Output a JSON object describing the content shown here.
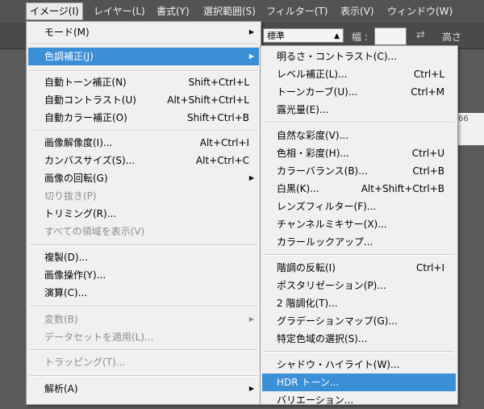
{
  "menubar": {
    "items": [
      {
        "label": "イメージ(I)"
      },
      {
        "label": "レイヤー(L)"
      },
      {
        "label": "書式(Y)"
      },
      {
        "label": "選択範囲(S)"
      },
      {
        "label": "フィルター(T)"
      },
      {
        "label": "表示(V)"
      },
      {
        "label": "ウィンドウ(W)"
      }
    ]
  },
  "optionsbar": {
    "style_value": "標準",
    "width_label": "幅 :",
    "height_label": "高さ"
  },
  "doc": {
    "fragment": "66"
  },
  "image_menu": {
    "items": [
      {
        "label": "モード(M)",
        "shortcut": "",
        "submenu": true
      },
      {
        "label": "色調補正(J)",
        "shortcut": "",
        "submenu": true
      },
      {
        "label": "自動トーン補正(N)",
        "shortcut": "Shift+Ctrl+L"
      },
      {
        "label": "自動コントラスト(U)",
        "shortcut": "Alt+Shift+Ctrl+L"
      },
      {
        "label": "自動カラー補正(O)",
        "shortcut": "Shift+Ctrl+B"
      },
      {
        "label": "画像解像度(I)...",
        "shortcut": "Alt+Ctrl+I"
      },
      {
        "label": "カンバスサイズ(S)...",
        "shortcut": "Alt+Ctrl+C"
      },
      {
        "label": "画像の回転(G)",
        "shortcut": "",
        "submenu": true
      },
      {
        "label": "切り抜き(P)",
        "shortcut": ""
      },
      {
        "label": "トリミング(R)...",
        "shortcut": ""
      },
      {
        "label": "すべての領域を表示(V)",
        "shortcut": ""
      },
      {
        "label": "複製(D)...",
        "shortcut": ""
      },
      {
        "label": "画像操作(Y)...",
        "shortcut": ""
      },
      {
        "label": "演算(C)...",
        "shortcut": ""
      },
      {
        "label": "変数(B)",
        "shortcut": "",
        "submenu": true
      },
      {
        "label": "データセットを適用(L)...",
        "shortcut": ""
      },
      {
        "label": "トラッピング(T)...",
        "shortcut": ""
      },
      {
        "label": "解析(A)",
        "shortcut": "",
        "submenu": true
      }
    ]
  },
  "adjust_menu": {
    "items": [
      {
        "label": "明るさ・コントラスト(C)...",
        "shortcut": ""
      },
      {
        "label": "レベル補正(L)...",
        "shortcut": "Ctrl+L"
      },
      {
        "label": "トーンカーブ(U)...",
        "shortcut": "Ctrl+M"
      },
      {
        "label": "露光量(E)...",
        "shortcut": ""
      },
      {
        "label": "自然な彩度(V)...",
        "shortcut": ""
      },
      {
        "label": "色相・彩度(H)...",
        "shortcut": "Ctrl+U"
      },
      {
        "label": "カラーバランス(B)...",
        "shortcut": "Ctrl+B"
      },
      {
        "label": "白黒(K)...",
        "shortcut": "Alt+Shift+Ctrl+B"
      },
      {
        "label": "レンズフィルター(F)...",
        "shortcut": ""
      },
      {
        "label": "チャンネルミキサー(X)...",
        "shortcut": ""
      },
      {
        "label": "カラールックアップ...",
        "shortcut": ""
      },
      {
        "label": "階調の反転(I)",
        "shortcut": "Ctrl+I"
      },
      {
        "label": "ポスタリゼーション(P)...",
        "shortcut": ""
      },
      {
        "label": "2 階調化(T)...",
        "shortcut": ""
      },
      {
        "label": "グラデーションマップ(G)...",
        "shortcut": ""
      },
      {
        "label": "特定色域の選択(S)...",
        "shortcut": ""
      },
      {
        "label": "シャドウ・ハイライト(W)...",
        "shortcut": ""
      },
      {
        "label": "HDR トーン...",
        "shortcut": ""
      },
      {
        "label": "バリエーション...",
        "shortcut": ""
      }
    ]
  }
}
